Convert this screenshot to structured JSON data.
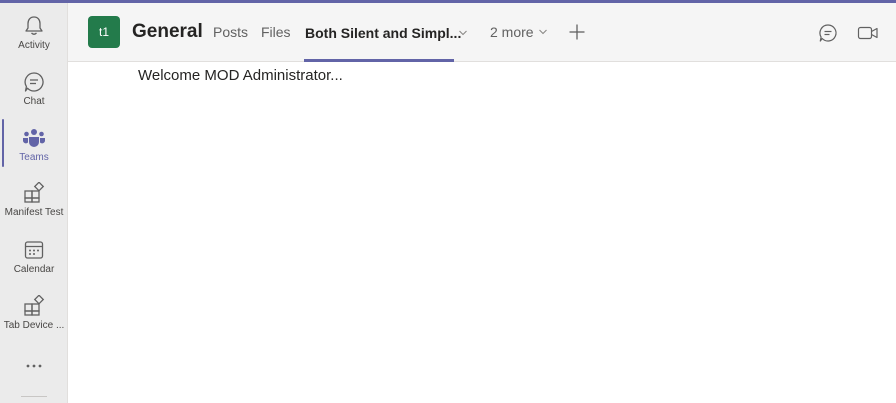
{
  "rail": {
    "items": [
      {
        "label": "Activity",
        "icon": "bell-icon"
      },
      {
        "label": "Chat",
        "icon": "chat-icon"
      },
      {
        "label": "Teams",
        "icon": "teams-icon",
        "active": true
      },
      {
        "label": "Manifest Test",
        "icon": "app-icon"
      },
      {
        "label": "Calendar",
        "icon": "calendar-icon"
      },
      {
        "label": "Tab Device ...",
        "icon": "app-icon"
      }
    ],
    "more_icon": "ellipsis-icon"
  },
  "header": {
    "team_initials": "t1",
    "team_color": "#237b4b",
    "channel_name": "General",
    "tabs": {
      "posts": "Posts",
      "files": "Files",
      "active": "Both Silent and Simpl...",
      "more": "2 more"
    }
  },
  "content": {
    "welcome_text": "Welcome MOD Administrator..."
  },
  "colors": {
    "accent": "#6264a7",
    "rail_bg": "#ebebeb",
    "header_bg": "#f5f5f5"
  }
}
